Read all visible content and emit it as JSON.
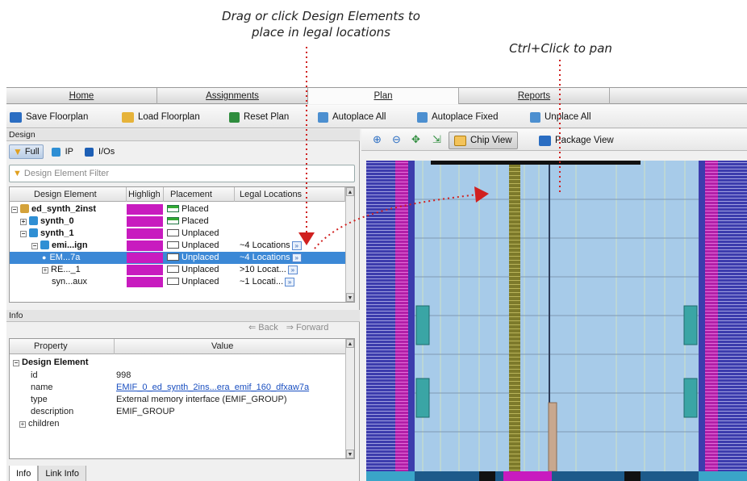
{
  "callouts": {
    "drag_line1": "Drag or click Design Elements to",
    "drag_line2": "place in legal locations",
    "pan": "Ctrl+Click to pan"
  },
  "tabs": [
    "Home",
    "Assignments",
    "Plan",
    "Reports"
  ],
  "active_tab": "Plan",
  "toolbar": {
    "save": "Save Floorplan",
    "load": "Load Floorplan",
    "reset": "Reset Plan",
    "autoplace_all": "Autoplace All",
    "autoplace_fixed": "Autoplace Fixed",
    "unplace_all": "Unplace All"
  },
  "design_panel": {
    "title": "Design",
    "filters": [
      "Full",
      "IP",
      "I/Os"
    ],
    "filter_placeholder": "Design Element Filter",
    "columns": [
      "Design Element",
      "Highligh",
      "Placement",
      "Legal Locations"
    ],
    "rows": [
      {
        "name": "ed_synth_2inst",
        "placement": "Placed",
        "locations": ""
      },
      {
        "name": "synth_0",
        "placement": "Placed",
        "locations": ""
      },
      {
        "name": "synth_1",
        "placement": "Unplaced",
        "locations": ""
      },
      {
        "name": "emi...ign",
        "placement": "Unplaced",
        "locations": "~4 Locations"
      },
      {
        "name": "EM...7a",
        "placement": "Unplaced",
        "locations": "~4 Locations"
      },
      {
        "name": "RE..._1",
        "placement": "Unplaced",
        "locations": ">10 Locat..."
      },
      {
        "name": "syn...aux",
        "placement": "Unplaced",
        "locations": "~1 Locati..."
      }
    ]
  },
  "info_panel": {
    "title": "Info",
    "back": "Back",
    "forward": "Forward",
    "columns": [
      "Property",
      "Value"
    ],
    "group": "Design Element",
    "props": [
      {
        "key": "id",
        "value": "998"
      },
      {
        "key": "name",
        "value": "EMIF_0_ed_synth_2ins...era_emif_160_dfxaw7a"
      },
      {
        "key": "type",
        "value": "External memory interface (EMIF_GROUP)"
      },
      {
        "key": "description",
        "value": "EMIF_GROUP"
      },
      {
        "key": "children",
        "value": ""
      }
    ],
    "bottom_tabs": [
      "Info",
      "Link Info"
    ]
  },
  "chip_toolbar": {
    "chip_view": "Chip View",
    "package_view": "Package View"
  },
  "colors": {
    "highlight": "#c81bbf",
    "selection": "#3b88d6",
    "io_blue": "#3c3cad",
    "lab_light": "#a7cbe9",
    "dsp_olive": "#7d7a2b",
    "teal": "#3aa5a5",
    "arrow_red": "#d0201f"
  }
}
